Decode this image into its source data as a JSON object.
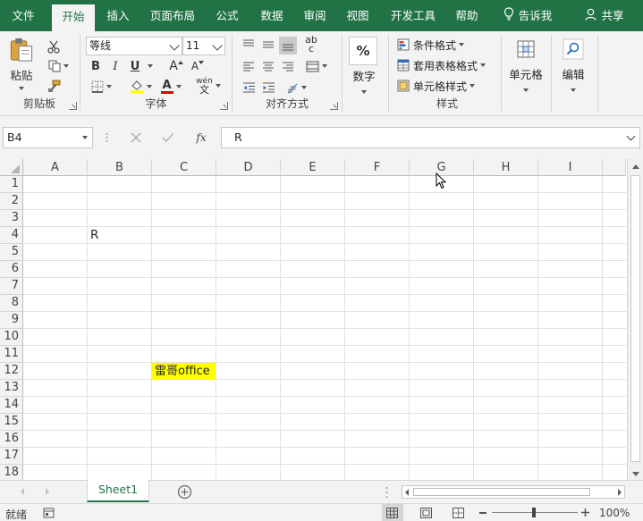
{
  "tabs": [
    {
      "label": "文件",
      "active": false
    },
    {
      "label": "开始",
      "active": true
    },
    {
      "label": "插入",
      "active": false
    },
    {
      "label": "页面布局",
      "active": false
    },
    {
      "label": "公式",
      "active": false
    },
    {
      "label": "数据",
      "active": false
    },
    {
      "label": "审阅",
      "active": false
    },
    {
      "label": "视图",
      "active": false
    },
    {
      "label": "开发工具",
      "active": false
    },
    {
      "label": "帮助",
      "active": false
    }
  ],
  "tell_me": "告诉我",
  "share": "共享",
  "ribbon": {
    "clipboard": {
      "label": "剪贴板",
      "paste": "粘贴"
    },
    "font": {
      "label": "字体",
      "font_name": "等线",
      "font_size": "11",
      "bold": "B",
      "italic": "I",
      "underline": "U",
      "grow": "A",
      "shrink": "A",
      "font_color_glyph": "A",
      "phonetic_top": "wén",
      "phonetic_bottom": "文"
    },
    "alignment": {
      "label": "对齐方式",
      "wrap_glyph": "ab",
      "wrap_glyph2": "c"
    },
    "number": {
      "label": "数字",
      "percent": "%"
    },
    "styles": {
      "label": "样式",
      "conditional": "条件格式",
      "table": "套用表格格式",
      "cell_styles": "单元格样式"
    },
    "cells": {
      "label": "单元格"
    },
    "editing": {
      "label": "编辑"
    }
  },
  "formula_bar": {
    "name_box": "B4",
    "fx": "fx",
    "content": "R"
  },
  "columns": [
    "A",
    "B",
    "C",
    "D",
    "E",
    "F",
    "G",
    "H",
    "I"
  ],
  "rows": [
    "1",
    "2",
    "3",
    "4",
    "5",
    "6",
    "7",
    "8",
    "9",
    "10",
    "11",
    "12",
    "13",
    "14",
    "15",
    "16",
    "17",
    "18"
  ],
  "cells": {
    "B4": "R",
    "C12": "雷哥office"
  },
  "highlight_color": "#ffff00",
  "accent_color": "#217346",
  "sheet_tab": "Sheet1",
  "status": {
    "ready": "就绪",
    "zoom": "100%"
  }
}
